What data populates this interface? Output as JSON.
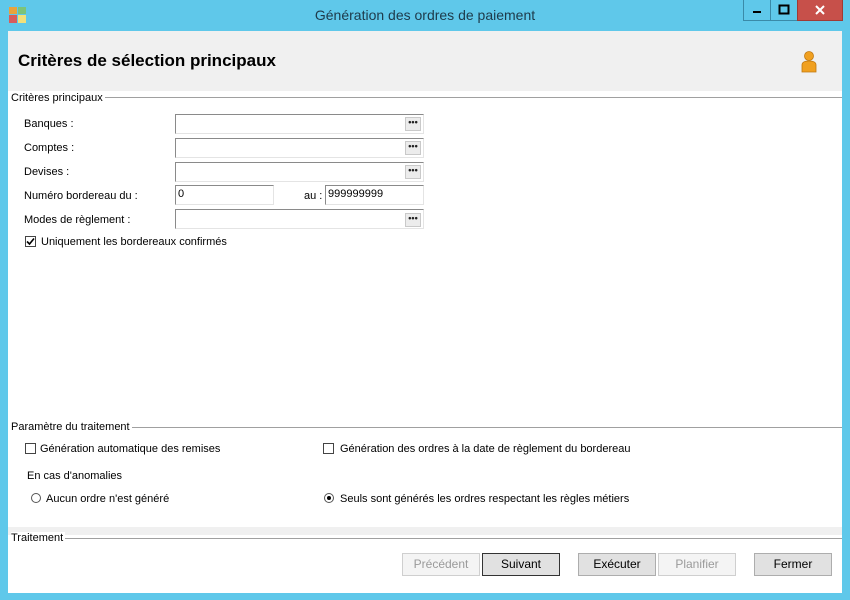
{
  "window": {
    "title": "Génération des ordres de paiement"
  },
  "icons": {
    "app": "app-grid-icon",
    "minimize": "minimize-icon",
    "maximize": "maximize-icon",
    "close": "close-icon",
    "user": "user-icon",
    "ellipsis": "ellipsis-icon"
  },
  "colors": {
    "titlebar": "#5fc8ea",
    "close_button": "#c7504a",
    "header_band": "#f0f0f0"
  },
  "header": {
    "title": "Critères de sélection principaux"
  },
  "criteria": {
    "group_label": "Critères principaux",
    "banques_label": "Banques :",
    "banques_value": "",
    "comptes_label": "Comptes :",
    "comptes_value": "",
    "devises_label": "Devises :",
    "devises_value": "",
    "numero_label": "Numéro bordereau du :",
    "numero_from": "0",
    "au_label": "au :",
    "numero_to": "999999999",
    "modes_label": "Modes de règlement :",
    "modes_value": "",
    "ellipsis": "•••",
    "confirmed_label": "Uniquement les bordereaux confirmés",
    "confirmed_checked": true
  },
  "params": {
    "group_label": "Paramètre du traitement",
    "auto_remises_label": "Génération automatique des remises",
    "auto_remises_checked": false,
    "date_reglement_label": "Génération des ordres à la date de règlement du bordereau",
    "date_reglement_checked": false,
    "anomalies_label": "En cas d'anomalies",
    "radio_none_label": "Aucun ordre n'est généré",
    "radio_rules_label": "Seuls sont générés les ordres respectant les règles métiers",
    "selected_radio": "rules"
  },
  "traitement": {
    "group_label": "Traitement",
    "precedent": "Précédent",
    "suivant": "Suivant",
    "executer": "Exécuter",
    "planifier": "Planifier",
    "fermer": "Fermer"
  }
}
